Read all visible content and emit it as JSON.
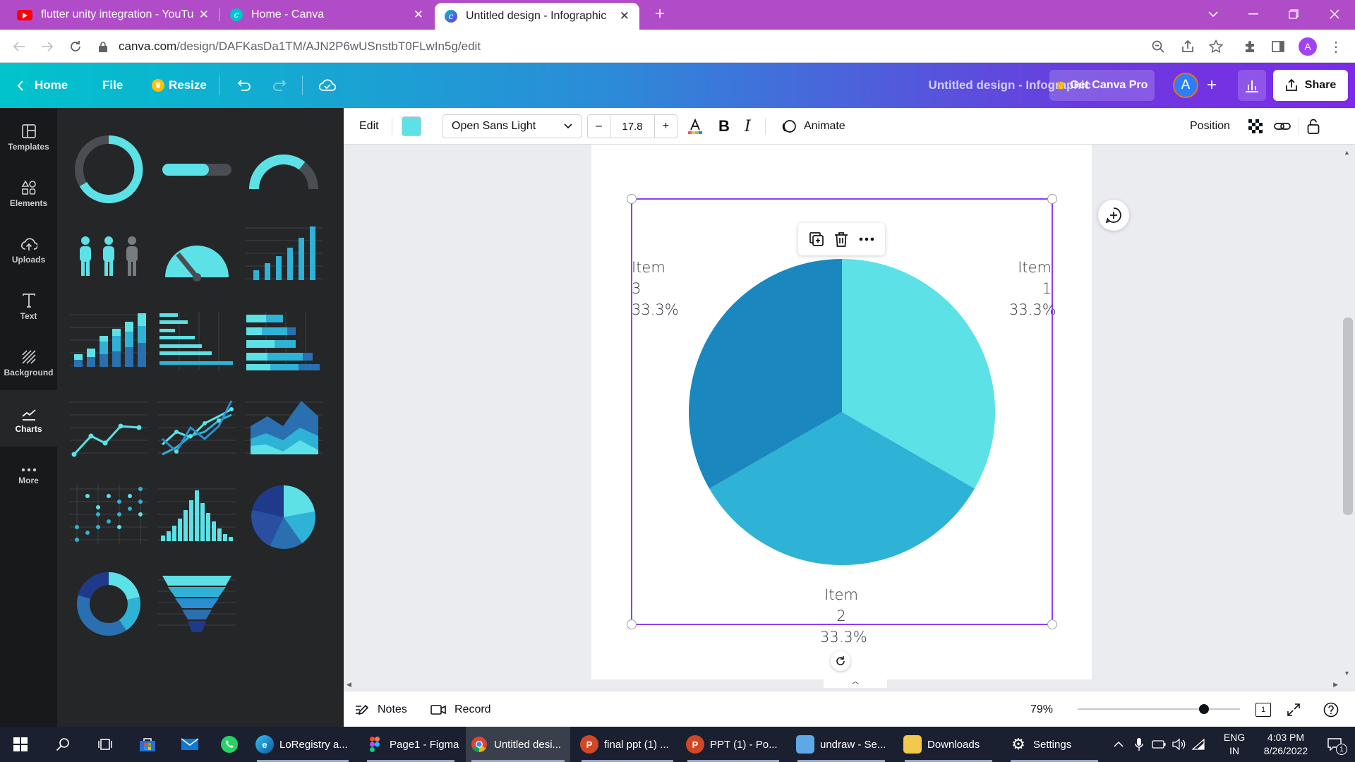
{
  "browser": {
    "tabs": [
      {
        "title": "flutter unity integration - YouTube",
        "icon": "youtube-icon"
      },
      {
        "title": "Home - Canva",
        "icon": "canva-icon"
      },
      {
        "title": "Untitled design - Infographic",
        "icon": "canva-icon",
        "active": true
      }
    ],
    "url_host": "canva.com",
    "url_path": "/design/DAFKasDa1TM/AJN2P6wUSnstbT0FLwIn5g/edit",
    "profile_initial": "A"
  },
  "canva": {
    "home_label": "Home",
    "file_label": "File",
    "resize_label": "Resize",
    "doc_title": "Untitled design - Infographic",
    "get_pro_label": "Get Canva Pro",
    "avatar_initial": "A",
    "share_label": "Share"
  },
  "sidebar": {
    "items": [
      {
        "label": "Templates",
        "icon": "templates-icon"
      },
      {
        "label": "Elements",
        "icon": "elements-icon"
      },
      {
        "label": "Uploads",
        "icon": "uploads-icon"
      },
      {
        "label": "Text",
        "icon": "text-icon"
      },
      {
        "label": "Background",
        "icon": "background-icon"
      },
      {
        "label": "Charts",
        "icon": "charts-icon",
        "active": true
      },
      {
        "label": "More",
        "icon": "more-icon"
      }
    ]
  },
  "toolbar": {
    "edit_label": "Edit",
    "color_swatch": "#5ce1e6",
    "font_name": "Open Sans Light",
    "font_size": "17.8",
    "minus": "–",
    "plus": "+",
    "bold": "B",
    "italic": "I",
    "animate_label": "Animate",
    "position_label": "Position"
  },
  "chart_data": {
    "type": "pie",
    "categories": [
      "Item 1",
      "Item 2",
      "Item 3"
    ],
    "values": [
      33.3,
      33.3,
      33.3
    ],
    "value_labels": [
      "33.3%",
      "33.3%",
      "33.3%"
    ],
    "colors": [
      "#5ce1e6",
      "#2eb2d6",
      "#1a88bf"
    ],
    "title": ""
  },
  "footer": {
    "notes_label": "Notes",
    "record_label": "Record",
    "zoom_label": "79%",
    "zoom_level": 0.79,
    "page_count": "1"
  },
  "taskbar": {
    "apps": [
      {
        "label": "LoRegistry a...",
        "icon": "edge-icon"
      },
      {
        "label": "Page1 - Figma",
        "icon": "figma-icon"
      },
      {
        "label": "Untitled desi...",
        "icon": "chrome-icon"
      },
      {
        "label": "final ppt (1) ...",
        "icon": "powerpoint-icon"
      },
      {
        "label": "PPT (1) - Po...",
        "icon": "powerpoint-icon"
      },
      {
        "label": "undraw - Se...",
        "icon": "file-icon"
      },
      {
        "label": "Downloads",
        "icon": "folder-icon"
      },
      {
        "label": "Settings",
        "icon": "settings-icon"
      }
    ],
    "lang_line1": "ENG",
    "lang_line2": "IN",
    "time": "4:03 PM",
    "date": "8/26/2022",
    "notif_count": "1"
  }
}
